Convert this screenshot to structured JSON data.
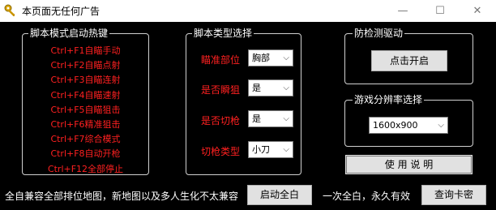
{
  "window": {
    "title": "本页面无任何广告",
    "minimize": "—",
    "maximize": "☐",
    "close": "✕"
  },
  "hotkeys": {
    "title": "脚本模式启动热键",
    "items": [
      "Ctrl+F1自瞄手动",
      "Ctrl+F2自瞄点射",
      "Ctrl+F3自瞄连射",
      "Ctrl+F4自瞄速射",
      "Ctrl+F5自瞄狙击",
      "Ctrl+F6精准狙击",
      "Ctrl+F7综合模式",
      "Ctrl+F8自动开枪",
      "Ctrl+F12全部停止"
    ]
  },
  "script_type": {
    "title": "脚本类型选择",
    "aim_label": "瞄准部位",
    "aim_value": "胸部",
    "instant_aim_label": "是否瞬狙",
    "instant_aim_value": "是",
    "switch_gun_label": "是否切枪",
    "switch_gun_value": "是",
    "switch_type_label": "切枪类型",
    "switch_type_value": "小刀"
  },
  "anti_detect": {
    "title": "防检测驱动",
    "start_button": "点击开启"
  },
  "resolution": {
    "title": "游戏分辨率选择",
    "value": "1600x900"
  },
  "usage_button": "使 用 说 明",
  "footer": {
    "note_left": "全自兼容全部排位地图，新地图以及多人生化不太兼容",
    "start_all_button": "启动全白",
    "note_right": "一次全白，永久有效",
    "query_button": "查询卡密"
  }
}
